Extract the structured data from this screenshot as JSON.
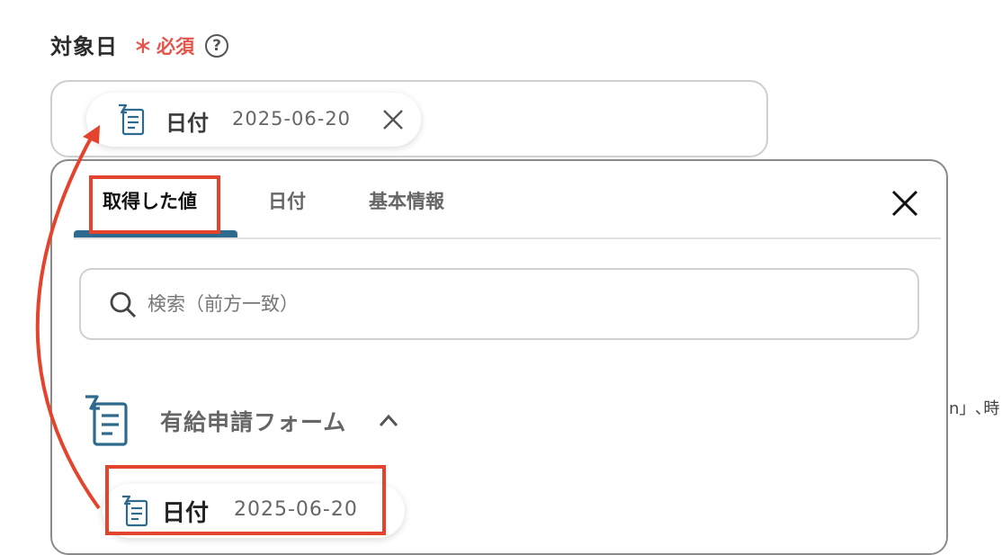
{
  "field": {
    "label": "対象日",
    "required_mark": "∗",
    "required_text": "必須",
    "help_icon": "question-circle-icon",
    "chip": {
      "label": "日付",
      "value": "2025-06-20",
      "icon": "form-doc-icon",
      "remove_icon": "close-icon"
    }
  },
  "panel": {
    "tabs": [
      {
        "label": "取得した値",
        "active": true
      },
      {
        "label": "日付",
        "active": false
      },
      {
        "label": "基本情報",
        "active": false
      }
    ],
    "close_icon": "close-icon",
    "search": {
      "placeholder": "検索（前方一致）",
      "value": "",
      "icon": "search-icon"
    },
    "group": {
      "title": "有給申請フォーム",
      "icon": "form-doc-icon",
      "expanded": true,
      "items": [
        {
          "label": "日付",
          "value": "2025-06-20"
        }
      ]
    }
  },
  "background_text": "on」､時",
  "colors": {
    "accent": "#2e6a8e",
    "required": "#e4544a",
    "annotation": "#e4432d"
  }
}
